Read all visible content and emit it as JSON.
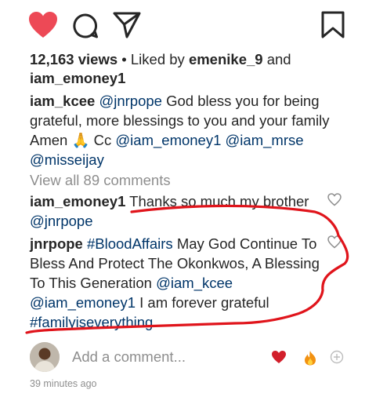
{
  "post": {
    "views_count": "12,163 views",
    "liked_by_prefix": " • Liked by ",
    "liked_by_user": "emenike_9",
    "liked_by_and": " and",
    "liked_by_user2": "iam_emoney1"
  },
  "caption": {
    "username": "iam_kcee",
    "mention1": "@jnrpope",
    "text1": " God bless you for being grateful, more blessings to you and your family Amen ",
    "emoji": "🙏",
    "text2": " Cc ",
    "mention2": "@iam_emoney1",
    "mention3": "@iam_mrse",
    "mention4": "@misseijay"
  },
  "view_all_comments": "View all 89 comments",
  "comments": [
    {
      "username": "iam_emoney1",
      "text": " Thanks so much my brother ",
      "mention": "@jnrpope"
    },
    {
      "username": "jnrpope",
      "hashtag1": "#BloodAffairs",
      "text1": " May God Continue To Bless And Protect The Okonkwos, A Blessing To This Generation ",
      "mention1": "@iam_kcee",
      "mention2": "@iam_emoney1",
      "text2": " I am forever grateful ",
      "hashtag2": "#familyiseverything"
    }
  ],
  "add_comment": {
    "placeholder": "Add a comment..."
  },
  "timestamp": "39 minutes ago",
  "icons": {
    "like": "heart-filled-icon",
    "comment": "comment-bubble-icon",
    "share": "paper-plane-icon",
    "save": "bookmark-icon",
    "comment_like": "heart-outline-icon",
    "quick_heart": "red-heart-emoji-icon",
    "quick_fire": "fire-emoji-icon",
    "quick_add": "add-circle-icon"
  },
  "colors": {
    "like_red": "#ed4956",
    "link_blue": "#003569",
    "muted_gray": "#8e8e8e",
    "annotation_red": "#e0141b"
  }
}
